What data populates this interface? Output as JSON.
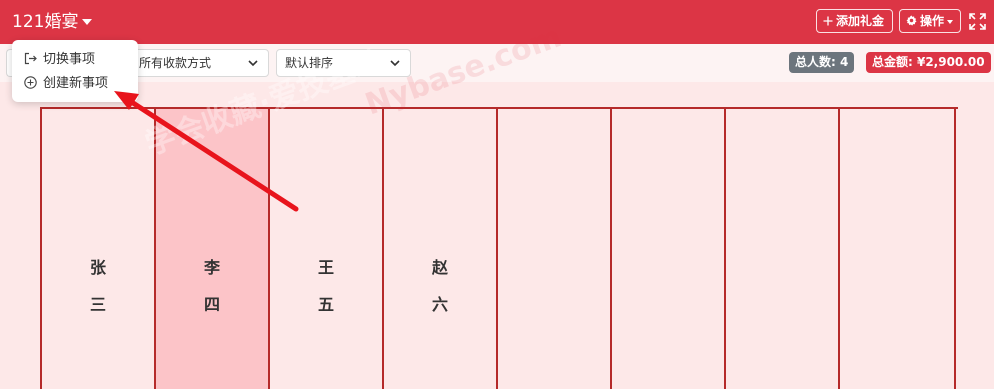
{
  "header": {
    "event_title": "121婚宴",
    "add_gift_label": "添加礼金",
    "operations_label": "操作"
  },
  "dropdown_menu": {
    "items": [
      {
        "label": "切换事项",
        "icon": "switch-icon"
      },
      {
        "label": "创建新事项",
        "icon": "plus-circle-icon"
      }
    ]
  },
  "filters": {
    "payment_method": "所有收款方式",
    "sort_order": "默认排序"
  },
  "summary": {
    "total_people": "总人数: 4",
    "total_amount": "总金额: ¥2,900.00"
  },
  "guests": [
    {
      "line1": "张",
      "line2": "三"
    },
    {
      "line1": "李",
      "line2": "四"
    },
    {
      "line1": "王",
      "line2": "五"
    },
    {
      "line1": "赵",
      "line2": "六"
    },
    {
      "line1": "",
      "line2": ""
    },
    {
      "line1": "",
      "line2": ""
    },
    {
      "line1": "",
      "line2": ""
    },
    {
      "line1": "",
      "line2": ""
    }
  ],
  "watermark": {
    "line1": "学会收藏·爱技基地",
    "line2": "Nybase.com"
  },
  "colors": {
    "primary": "#dc3545",
    "board_background": "#fde8e8",
    "highlight_column": "#fcc4c8",
    "badge_gray": "#6c757d",
    "annotation_arrow": "#e8141c"
  }
}
